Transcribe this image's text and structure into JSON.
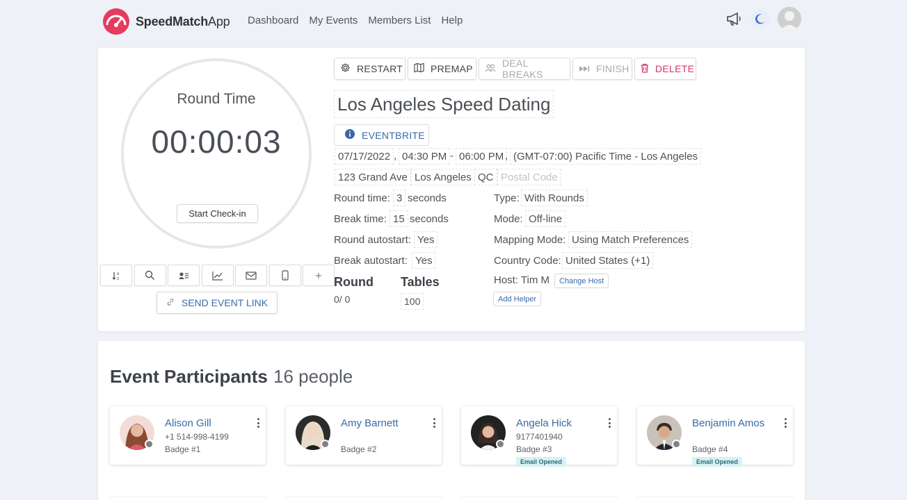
{
  "brand": {
    "name_bold": "SpeedMatch",
    "name_light": "App",
    "accent": "#e63a5f"
  },
  "nav": {
    "links": [
      "Dashboard",
      "My Events",
      "Members List",
      "Help"
    ]
  },
  "timer": {
    "label": "Round Time",
    "value": "00:00:03",
    "checkin_label": "Start Check-in"
  },
  "tools": {
    "icons": [
      "sort-icon",
      "search-icon",
      "contact-card-icon",
      "chart-icon",
      "mail-icon",
      "phone-icon",
      "plus-icon"
    ]
  },
  "send_link_label": "SEND EVENT LINK",
  "actions": {
    "restart": "RESTART",
    "premap": "PREMAP",
    "deal_breaks": "DEAL BREAKS",
    "finish": "FINISH",
    "delete": "DELETE"
  },
  "event": {
    "title": "Los Angeles Speed Dating",
    "source_label": "EVENTBRITE",
    "date": "07/17/2022",
    "start_time": "04:30 PM",
    "end_time": "06:00 PM",
    "timezone": "(GMT-07:00) Pacific Time - Los Angeles",
    "address": "123 Grand Ave",
    "city": "Los Angeles",
    "region": "QC",
    "postal_placeholder": "Postal Code",
    "round_time_label": "Round time:",
    "round_time_value": "3",
    "round_time_unit": "seconds",
    "break_time_label": "Break time:",
    "break_time_value": "15",
    "break_time_unit": "seconds",
    "round_autostart_label": "Round autostart:",
    "round_autostart_value": "Yes",
    "break_autostart_label": "Break autostart:",
    "break_autostart_value": "Yes",
    "type_label": "Type:",
    "type_value": "With Rounds",
    "mode_label": "Mode:",
    "mode_value": "Off-line",
    "mapping_label": "Mapping Mode:",
    "mapping_value": "Using Match Preferences",
    "country_label": "Country Code:",
    "country_value": "United States (+1)",
    "host_label": "Host: Tim M",
    "change_host_label": "Change Host",
    "add_helper_label": "Add Helper",
    "round_heading": "Round",
    "round_value": "0/ 0",
    "tables_heading": "Tables",
    "tables_value": "100"
  },
  "participants": {
    "title": "Event Participants",
    "count": "16 people",
    "items": [
      {
        "name": "Alison Gill",
        "phone": "+1 514-998-4199",
        "badge": "Badge #1",
        "tag": ""
      },
      {
        "name": "Amy Barnett",
        "phone": "",
        "badge": "Badge #2",
        "tag": ""
      },
      {
        "name": "Angela Hick",
        "phone": "9177401940",
        "badge": "Badge #3",
        "tag": "Email Opened"
      },
      {
        "name": "Benjamin Amos",
        "phone": "",
        "badge": "Badge #4",
        "tag": "Email Opened"
      }
    ]
  }
}
